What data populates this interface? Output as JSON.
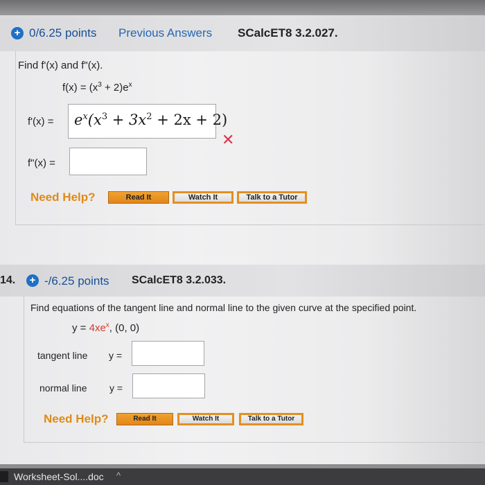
{
  "q13": {
    "points": "0/6.25 points",
    "previous_answers": "Previous Answers",
    "code": "SCalcET8 3.2.027.",
    "prompt": "Find f'(x) and f\"(x).",
    "fx_lhs": "f(x) = (x",
    "fx_exp": "3",
    "fx_mid": " + 2)e",
    "fx_sup": "x",
    "fprime_label": "f'(x) =",
    "fprime_answer": {
      "e": "e",
      "e_sup": "x",
      "open": "(x",
      "sup3": "3",
      "mid": " + 3x",
      "sup2": "2",
      "tail": " + 2x + 2)"
    },
    "fdoubleprime_label": "f\"(x) =",
    "fdoubleprime_value": "",
    "wrong_mark": "✕",
    "need_help": "Need Help?",
    "read_it": "Read It",
    "watch_it": "Watch It",
    "talk_tutor": "Talk to a Tutor"
  },
  "q14": {
    "number": "14.",
    "points": "-/6.25 points",
    "code": "SCalcET8 3.2.033.",
    "prompt": "Find equations of the tangent line and normal line to the given curve at the specified point.",
    "eq_y": "y = ",
    "eq_4x": "4xe",
    "eq_sup": "x",
    "eq_point": ",   (0, 0)",
    "tangent_label": "tangent line",
    "normal_label": "normal line",
    "y_eq": "y =",
    "tangent_value": "",
    "normal_value": "",
    "need_help": "Need Help?",
    "read_it": "Read It",
    "watch_it": "Watch It",
    "talk_tutor": "Talk to a Tutor"
  },
  "download_bar": {
    "filename": "Worksheet-Sol....doc",
    "chevron": "^"
  }
}
